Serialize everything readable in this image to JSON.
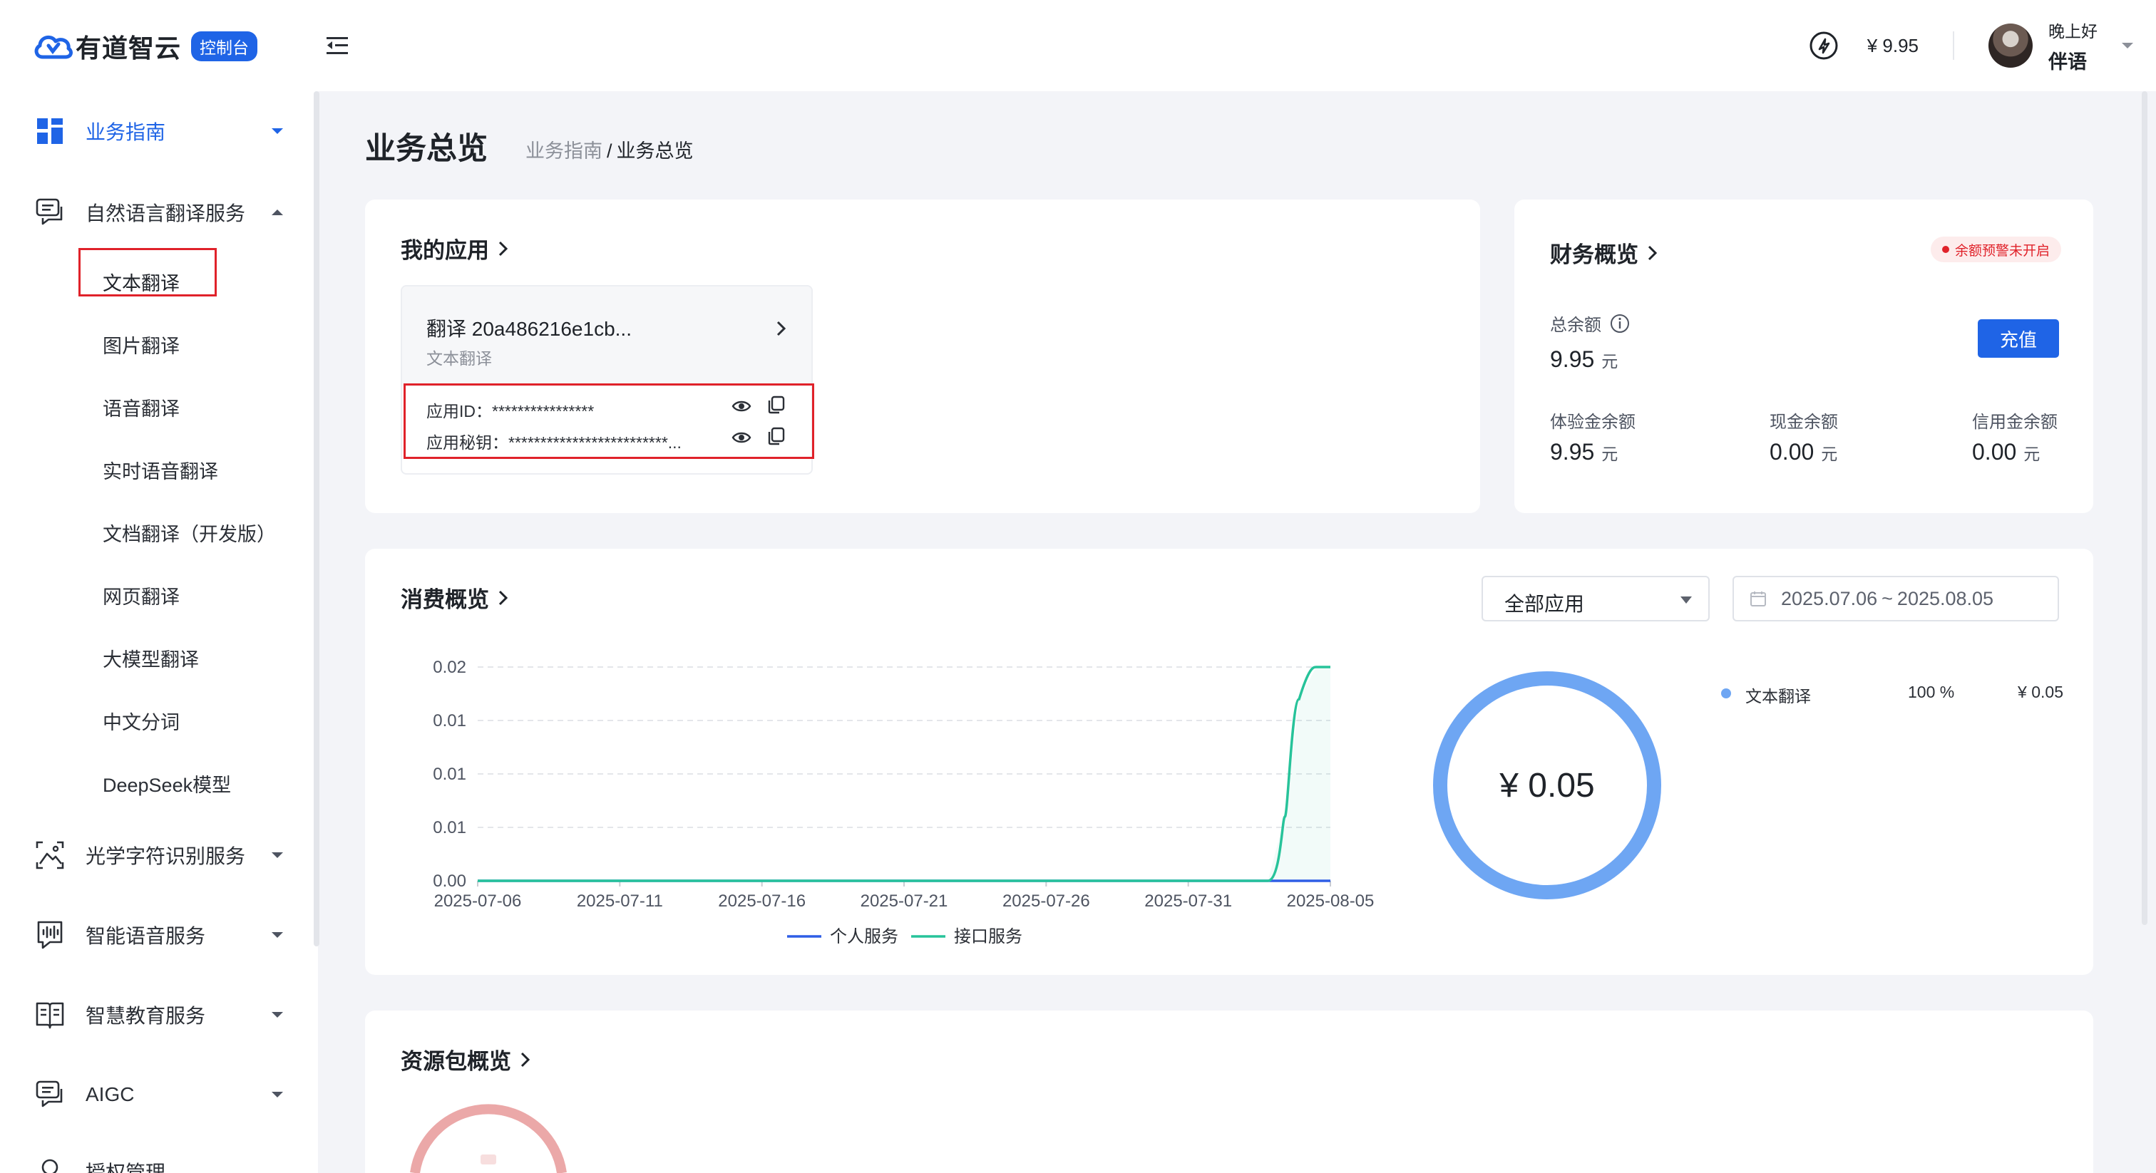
{
  "header": {
    "brand": "有道智云",
    "badge": "控制台",
    "balance": "¥ 9.95",
    "greeting": "晚上好",
    "username": "伴语"
  },
  "sidebar": {
    "groups": [
      {
        "label": "业务指南",
        "icon": "grid-icon",
        "expanded": false,
        "active": true
      },
      {
        "label": "自然语言翻译服务",
        "icon": "chat-translate-icon",
        "expanded": true,
        "active": false
      },
      {
        "label": "光学字符识别服务",
        "icon": "image-scan-icon",
        "expanded": false,
        "active": false
      },
      {
        "label": "智能语音服务",
        "icon": "voice-wave-icon",
        "expanded": false,
        "active": false
      },
      {
        "label": "智慧教育服务",
        "icon": "book-icon",
        "expanded": false,
        "active": false
      },
      {
        "label": "AIGC",
        "icon": "aigc-chat-icon",
        "expanded": false,
        "active": false
      },
      {
        "label": "授权管理",
        "icon": "key-icon",
        "expanded": false,
        "active": false
      }
    ],
    "items": [
      "文本翻译",
      "图片翻译",
      "语音翻译",
      "实时语音翻译",
      "文档翻译（开发版）",
      "网页翻译",
      "大模型翻译",
      "中文分词",
      "DeepSeek模型"
    ]
  },
  "page": {
    "title": "业务总览",
    "breadcrumb": [
      "业务指南",
      "业务总览"
    ]
  },
  "my_apps": {
    "title": "我的应用",
    "app": {
      "name": "翻译 20a486216e1cb...",
      "type": "文本翻译",
      "app_id_label": "应用ID：",
      "app_id_value": "****************",
      "secret_label": "应用秘钥：",
      "secret_value": "*************************..."
    }
  },
  "finance": {
    "title": "财务概览",
    "warning": "余额预警未开启",
    "total_label": "总余额",
    "total_value": "9.95",
    "unit": "元",
    "recharge": "充值",
    "items": [
      {
        "label": "体验金余额",
        "value": "9.95"
      },
      {
        "label": "现金余额",
        "value": "0.00"
      },
      {
        "label": "信用金余额",
        "value": "0.00"
      }
    ]
  },
  "consumption": {
    "title": "消费概览",
    "filter_value": "全部应用",
    "date_start": "2025.07.06",
    "date_end": "2025.08.05",
    "donut_total": "¥ 0.05",
    "breakdown": [
      {
        "name": "文本翻译",
        "percent": "100 %",
        "amount": "¥ 0.05",
        "color": "#6ea6f3"
      }
    ]
  },
  "resources": {
    "title": "资源包概览"
  },
  "chart_data": {
    "type": "line",
    "x": [
      "2025-07-06",
      "2025-07-11",
      "2025-07-16",
      "2025-07-21",
      "2025-07-26",
      "2025-07-31",
      "2025-08-05"
    ],
    "y_tick_labels": [
      "0.02",
      "0.01",
      "0.01",
      "0.01",
      "0.00"
    ],
    "ylim": [
      0,
      0.02
    ],
    "grid": true,
    "legend_position": "bottom",
    "series": [
      {
        "name": "个人服务",
        "color": "#2f5ee6",
        "points": [
          [
            0,
            0
          ],
          [
            30,
            0
          ]
        ]
      },
      {
        "name": "接口服务",
        "color": "#27c39a",
        "points": [
          [
            0,
            0
          ],
          [
            27.8,
            0
          ],
          [
            28.4,
            0.006
          ],
          [
            28.9,
            0.017
          ],
          [
            29.5,
            0.02
          ],
          [
            30,
            0.02
          ]
        ]
      }
    ]
  }
}
